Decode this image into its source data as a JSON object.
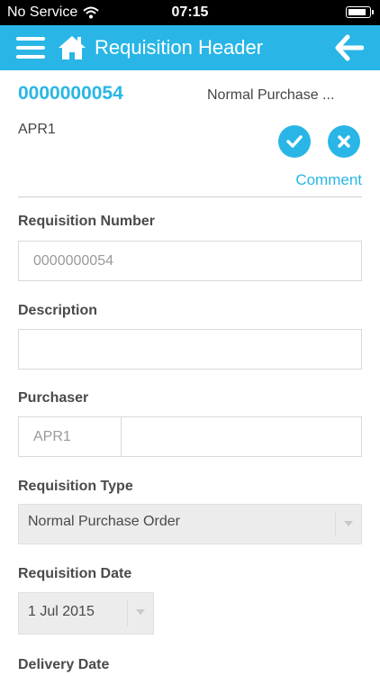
{
  "status_bar": {
    "carrier": "No Service",
    "time": "07:15",
    "battery_level": 0.9
  },
  "nav": {
    "title": "Requisition Header"
  },
  "header": {
    "requisition_id": "0000000054",
    "requisition_type": "Normal Purchase ...",
    "approver": "APR1",
    "comment_label": "Comment"
  },
  "form": {
    "requisition_number": {
      "label": "Requisition Number",
      "value": "0000000054"
    },
    "description": {
      "label": "Description",
      "value": ""
    },
    "purchaser": {
      "label": "Purchaser",
      "code": "APR1",
      "name": ""
    },
    "requisition_type": {
      "label": "Requisition Type",
      "selected": "Normal Purchase Order"
    },
    "requisition_date": {
      "label": "Requisition Date",
      "selected": "1 Jul 2015"
    },
    "delivery_date": {
      "label": "Delivery Date"
    }
  },
  "colors": {
    "accent": "#29b6e6",
    "status_bar": "#000000"
  }
}
